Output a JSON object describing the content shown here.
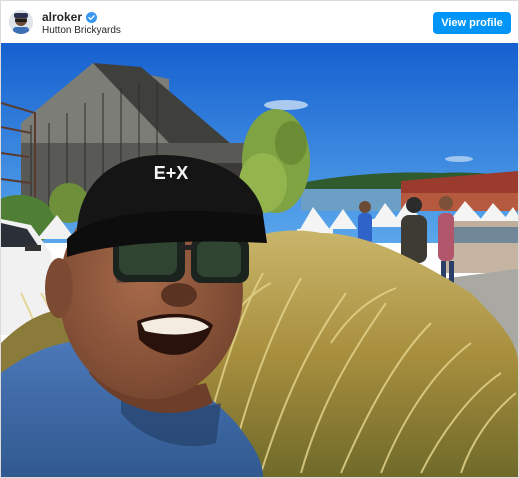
{
  "post": {
    "username": "alroker",
    "location": "Hutton Brickyards",
    "view_profile_label": "View profile",
    "photo_hat_text": "E+X"
  },
  "colors": {
    "primary_button": "#0095f6",
    "verified_badge": "#3897f0",
    "sky": "#1e6fd8"
  },
  "icons": [
    "avatar",
    "verified-badge-icon"
  ]
}
